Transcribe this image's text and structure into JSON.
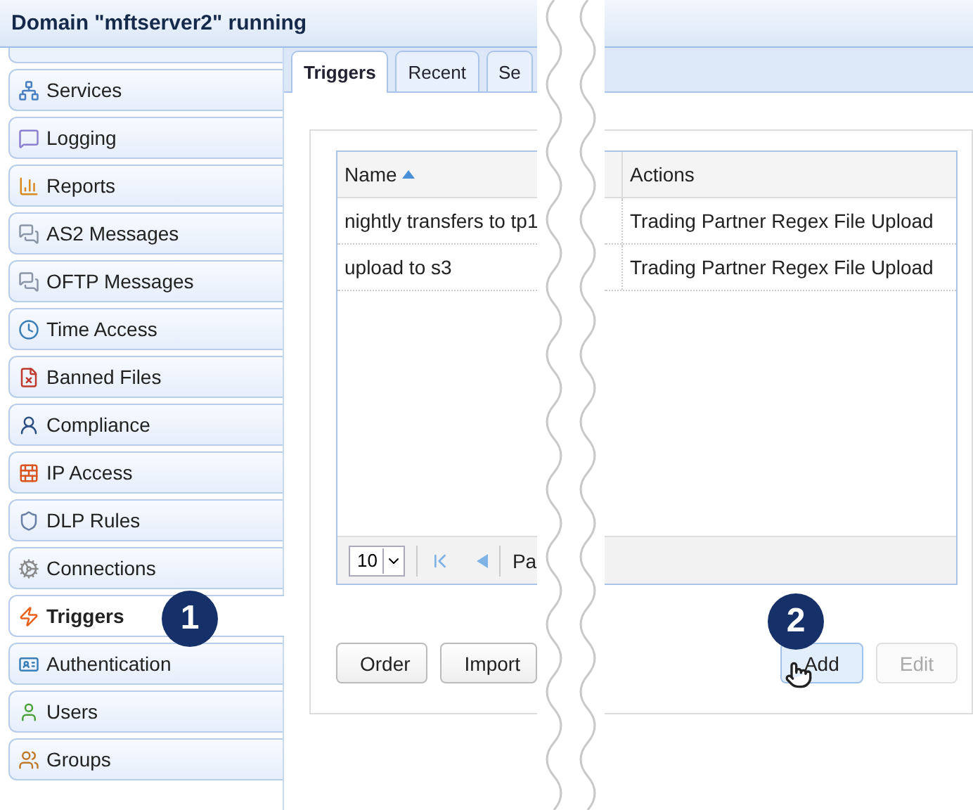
{
  "window": {
    "title": "Domain \"mftserver2\" running"
  },
  "sidebar": {
    "items": [
      {
        "label": "Services",
        "selected": false
      },
      {
        "label": "Logging",
        "selected": false
      },
      {
        "label": "Reports",
        "selected": false
      },
      {
        "label": "AS2 Messages",
        "selected": false
      },
      {
        "label": "OFTP Messages",
        "selected": false
      },
      {
        "label": "Time Access",
        "selected": false
      },
      {
        "label": "Banned Files",
        "selected": false
      },
      {
        "label": "Compliance",
        "selected": false
      },
      {
        "label": "IP Access",
        "selected": false
      },
      {
        "label": "DLP Rules",
        "selected": false
      },
      {
        "label": "Connections",
        "selected": false
      },
      {
        "label": "Triggers",
        "selected": true
      },
      {
        "label": "Authentication",
        "selected": false
      },
      {
        "label": "Users",
        "selected": false
      },
      {
        "label": "Groups",
        "selected": false
      }
    ]
  },
  "tabs": [
    {
      "label": "Triggers",
      "selected": true
    },
    {
      "label": "Recent",
      "selected": false
    },
    {
      "label": "Se",
      "selected": false
    }
  ],
  "table": {
    "columns": [
      {
        "label": "Name",
        "sorted": true
      },
      {
        "label": "Actions",
        "sorted": false
      }
    ],
    "rows": [
      [
        "nightly transfers to tp1",
        "Trading Partner Regex File Upload"
      ],
      [
        "upload to s3",
        "Trading Partner Regex File Upload"
      ]
    ]
  },
  "pagination": {
    "page_size": "10",
    "label": "Pa"
  },
  "buttons_left": [
    {
      "label": "Order",
      "disabled": false,
      "hovered": false
    },
    {
      "label": "Import",
      "disabled": false,
      "hovered": false
    }
  ],
  "buttons_right": [
    {
      "label": "Add",
      "disabled": false,
      "hovered": true
    },
    {
      "label": "Edit",
      "disabled": true,
      "hovered": false
    }
  ],
  "callouts": [
    {
      "number": "1"
    },
    {
      "number": "2"
    }
  ]
}
